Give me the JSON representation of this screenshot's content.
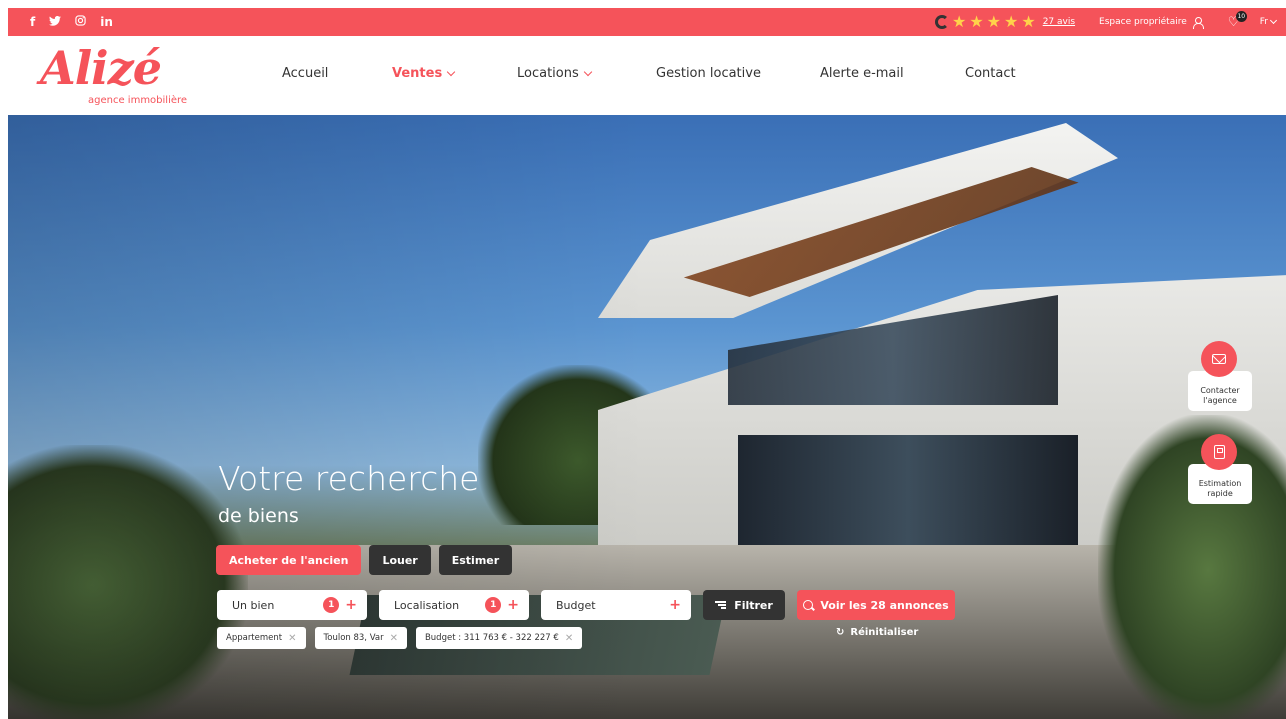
{
  "social": {
    "facebook": "f",
    "twitter": "🐦",
    "instagram": "◎",
    "linkedin": "in"
  },
  "topbar": {
    "rating_stars": 5,
    "reviews_label": "27 avis",
    "owner_space": "Espace propriétaire",
    "favorites_count": "10",
    "language": "Fr",
    "accent_color": "#f5535a"
  },
  "logo": {
    "name": "Alizé",
    "tagline": "agence immobilière"
  },
  "nav": {
    "items": [
      {
        "label": "Accueil"
      },
      {
        "label": "Ventes"
      },
      {
        "label": "Locations"
      },
      {
        "label": "Gestion locative"
      },
      {
        "label": "Alerte e-mail"
      },
      {
        "label": "Contact"
      }
    ]
  },
  "hero": {
    "title": "Votre recherche",
    "subtitle": "de biens"
  },
  "tabs": {
    "buy_old": "Acheter de l'ancien",
    "rent": "Louer",
    "estimate": "Estimer"
  },
  "search": {
    "property_label": "Un bien",
    "property_count": "1",
    "location_label": "Localisation",
    "location_count": "1",
    "budget_label": "Budget",
    "filter_label": "Filtrer",
    "submit_label": "Voir les 28 annonces",
    "reset_label": "Réinitialiser"
  },
  "chips": {
    "type": "Appartement",
    "location": "Toulon 83, Var",
    "budget": "Budget : 311 763 € - 322 227 €"
  },
  "side": {
    "contact": "Contacter l'agence",
    "estimate": "Estimation rapide"
  }
}
